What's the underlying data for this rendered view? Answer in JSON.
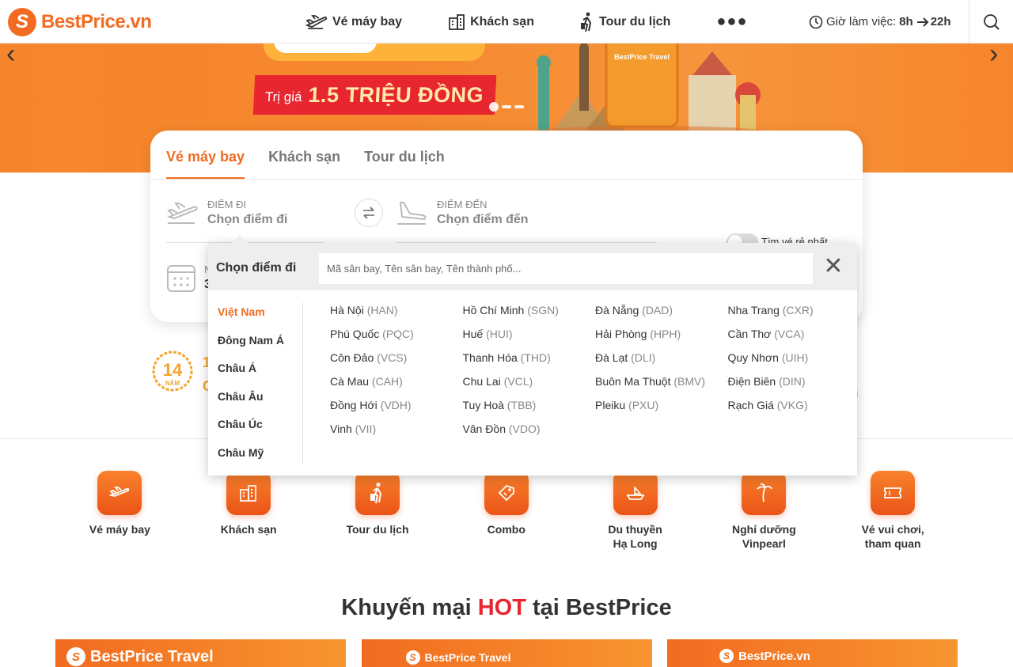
{
  "header": {
    "logo_text": "BestPrice.vn",
    "nav": [
      {
        "label": "Vé máy bay",
        "icon": "plane-icon"
      },
      {
        "label": "Khách sạn",
        "icon": "hotel-icon"
      },
      {
        "label": "Tour du lịch",
        "icon": "traveler-icon"
      }
    ],
    "more_label": "●●●",
    "hours_prefix": "Giờ làm việc:",
    "hours_open": "8h",
    "hours_close": "22h"
  },
  "banner": {
    "tag_small": "Trị giá",
    "tag_big": "1.5 TRIỆU ĐỒNG",
    "art_brand": "BestPrice Travel"
  },
  "search": {
    "tabs": [
      "Vé máy bay",
      "Khách sạn",
      "Tour du lịch"
    ],
    "from_label": "ĐIỂM ĐI",
    "from_value": "Chọn điểm đi",
    "to_label": "ĐIỂM ĐẾN",
    "to_value": "Chọn điểm đến",
    "date_label_fragment": "N",
    "date_value_fragment": "3",
    "cheapest_label": "Tìm vé rẻ nhất"
  },
  "dropdown": {
    "title": "Chọn điểm đi",
    "placeholder": "Mã sân bay, Tên sân bay, Tên thành phố...",
    "regions": [
      "Việt Nam",
      "Đông Nam Á",
      "Châu Á",
      "Châu Âu",
      "Châu Úc",
      "Châu Mỹ"
    ],
    "active_region": "Việt Nam",
    "cities": [
      {
        "name": "Hà Nội",
        "code": "(HAN)"
      },
      {
        "name": "Hồ Chí Minh",
        "code": "(SGN)"
      },
      {
        "name": "Đà Nẵng",
        "code": "(DAD)"
      },
      {
        "name": "Nha Trang",
        "code": "(CXR)"
      },
      {
        "name": "Phú Quốc",
        "code": "(PQC)"
      },
      {
        "name": "Huế",
        "code": "(HUI)"
      },
      {
        "name": "Hải Phòng",
        "code": "(HPH)"
      },
      {
        "name": "Cần Thơ",
        "code": "(VCA)"
      },
      {
        "name": "Côn Đảo",
        "code": "(VCS)"
      },
      {
        "name": "Thanh Hóa",
        "code": "(THD)"
      },
      {
        "name": "Đà Lạt",
        "code": "(DLI)"
      },
      {
        "name": "Quy Nhơn",
        "code": "(UIH)"
      },
      {
        "name": "Cà Mau",
        "code": "(CAH)"
      },
      {
        "name": "Chu Lai",
        "code": "(VCL)"
      },
      {
        "name": "Buôn Ma Thuột",
        "code": "(BMV)"
      },
      {
        "name": "Điện Biên",
        "code": "(DIN)"
      },
      {
        "name": "Đồng Hới",
        "code": "(VDH)"
      },
      {
        "name": "Tuy Hoà",
        "code": "(TBB)"
      },
      {
        "name": "Pleiku",
        "code": "(PXU)"
      },
      {
        "name": "Rạch Giá",
        "code": "(VKG)"
      },
      {
        "name": "Vinh",
        "code": "(VII)"
      },
      {
        "name": "Vân Đồn",
        "code": "(VDO)"
      }
    ]
  },
  "award": {
    "years": "14",
    "years_unit": "NĂM",
    "text1": "1",
    "text2": "C",
    "right_fragment": "ai"
  },
  "services": [
    {
      "label": "Vé máy bay",
      "icon": "plane-icon"
    },
    {
      "label": "Khách sạn",
      "icon": "hotel-icon"
    },
    {
      "label": "Tour du lịch",
      "icon": "traveler-icon"
    },
    {
      "label": "Combo",
      "icon": "tag-icon"
    },
    {
      "label": "Du thuyền\nHạ Long",
      "icon": "cruise-icon"
    },
    {
      "label": "Nghỉ dưỡng\nVinpearl",
      "icon": "resort-icon"
    },
    {
      "label": "Vé vui chơi,\ntham quan",
      "icon": "ticket-icon"
    }
  ],
  "promo": {
    "title_pre": "Khuyến mại",
    "title_hot": "HOT",
    "title_post": "tại BestPrice",
    "cards": [
      "BestPrice Travel",
      "BestPrice Travel",
      "BestPrice.vn"
    ]
  },
  "colors": {
    "brand": "#f26b21",
    "hot": "#e8262f"
  }
}
